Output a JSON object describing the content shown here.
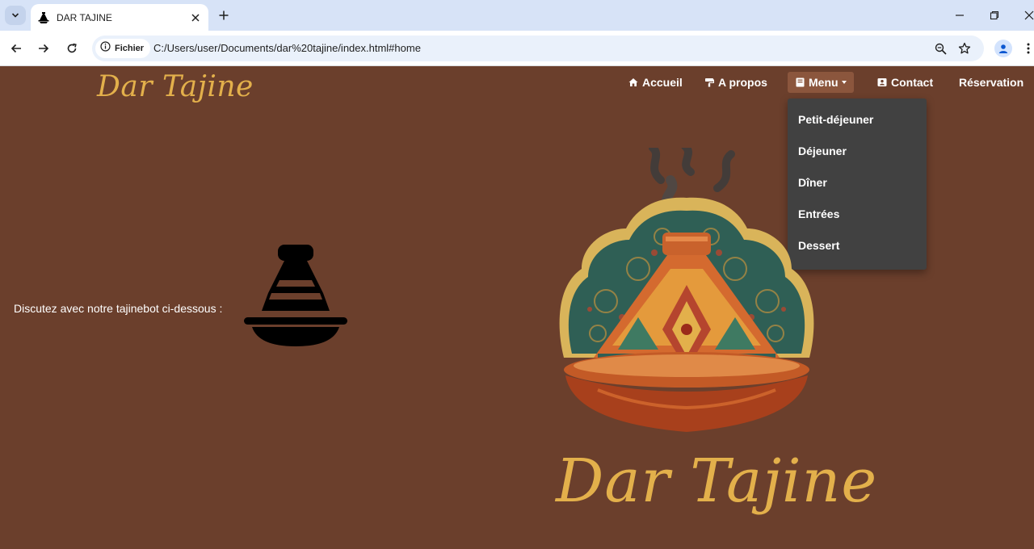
{
  "browser": {
    "tab_title": "DAR TAJINE",
    "chip_label": "Fichier",
    "url": "C:/Users/user/Documents/dar%20tajine/index.html#home",
    "icons": [
      "tab-search-icon",
      "tajine-favicon-icon",
      "close-icon",
      "plus-icon",
      "minimize-icon",
      "restore-icon",
      "close-window-icon",
      "back-icon",
      "forward-icon",
      "reload-icon",
      "info-icon",
      "zoom-icon",
      "star-icon",
      "profile-icon",
      "more-icon"
    ]
  },
  "site": {
    "brand": "Dar Tajine",
    "nav": {
      "home": "Accueil",
      "about": "A propos",
      "menu": "Menu",
      "contact": "Contact",
      "reservation": "Réservation"
    },
    "menu_items": [
      "Petit-déjeuner",
      "Déjeuner",
      "Dîner",
      "Entrées",
      "Dessert"
    ],
    "chat_prompt": "Discutez avec notre tajinebot ci-dessous :",
    "hero_title": "Dar Tajine"
  },
  "colors": {
    "page_background": "#6b3f2c",
    "brand_gold": "#e3b04b",
    "dropdown_background": "#414141",
    "active_nav_background": "#8b563d",
    "tabstrip": "#d7e3f7"
  }
}
